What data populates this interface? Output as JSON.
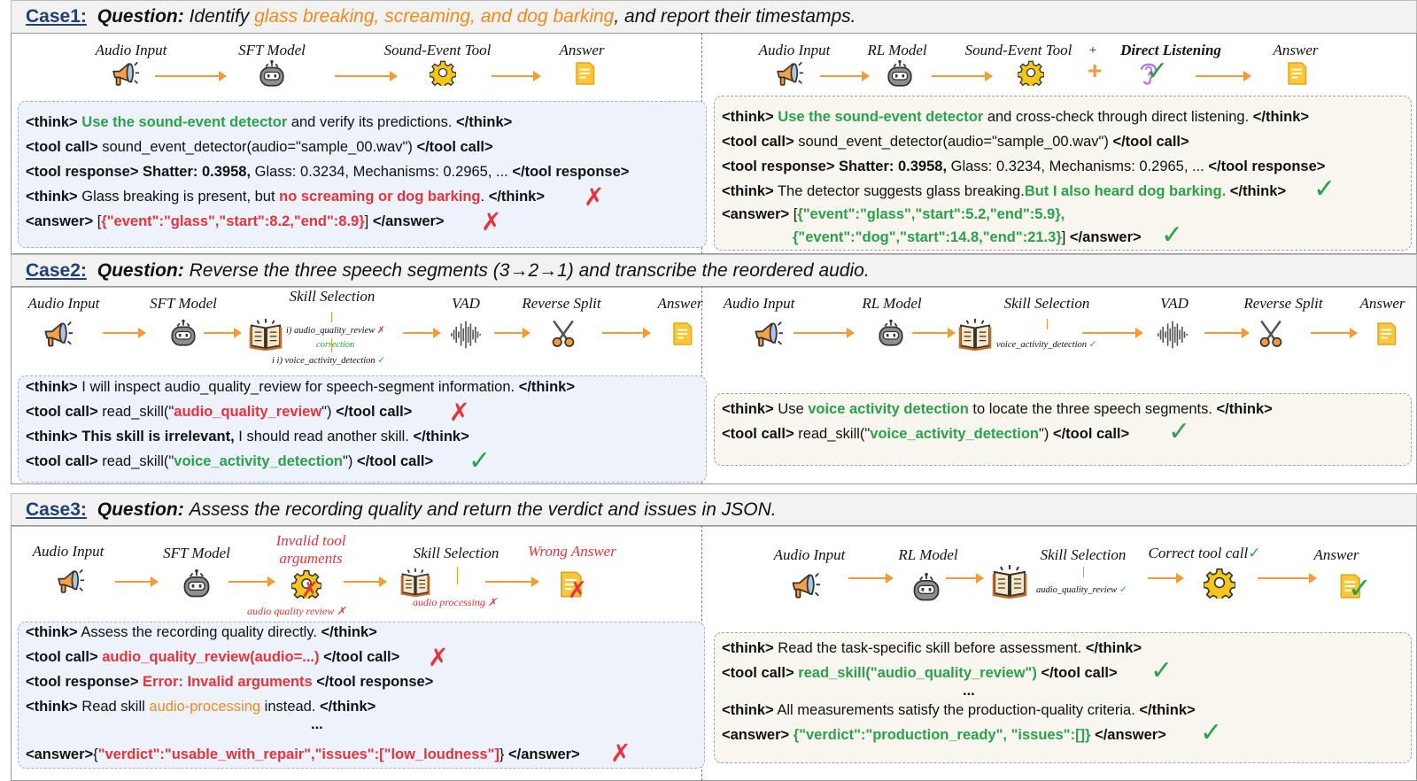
{
  "case1": {
    "num": "Case1:",
    "q_label": "Question:",
    "q_pre": "Identify ",
    "q_highlight": "glass breaking, screaming, and dog barking",
    "q_post": ", and report their timestamps.",
    "left_stages": [
      "Audio Input",
      "SFT Model",
      "Sound-Event Tool",
      "Answer"
    ],
    "right_stages": [
      "Audio Input",
      "RL Model",
      "Sound-Event Tool",
      "+",
      "Direct Listening",
      "Answer"
    ],
    "left_box": {
      "l1_tag": "<think>",
      "l1_g": "Use the sound-event detector",
      "l1_rest": " and verify its predictions. ",
      "l1_end": "</think>",
      "l2_tag": "<tool call>",
      "l2_rest": " sound_event_detector(audio=\"sample_00.wav\") ",
      "l2_end": "</tool call>",
      "l3_tag": "<tool response>",
      "l3_b": " Shatter: 0.3958,",
      "l3_rest": " Glass: 0.3234, Mechanisms: 0.2965, ... ",
      "l3_end": "</tool response>",
      "l4_tag": "<think>",
      "l4_rest": " Glass breaking is present, but ",
      "l4_r": "no screaming or dog barking",
      "l4_dot": ". ",
      "l4_end": "</think>",
      "l5_tag": "<answer>",
      "l5_open": " [",
      "l5_r": "{\"event\":\"glass\",\"start\":8.2,\"end\":8.9}",
      "l5_close": "] ",
      "l5_end": "</answer>"
    },
    "right_box": {
      "l1_tag": "<think>",
      "l1_g": "Use the sound-event detector",
      "l1_rest": " and cross-check through direct listening. ",
      "l1_end": "</think>",
      "l2_tag": "<tool call>",
      "l2_rest": " sound_event_detector(audio=\"sample_00.wav\") ",
      "l2_end": "</tool call>",
      "l3_tag": "<tool response>",
      "l3_b": " Shatter: 0.3958,",
      "l3_rest": " Glass: 0.3234, Mechanisms: 0.2965, ... ",
      "l3_end": "</tool response>",
      "l4_tag": "<think>",
      "l4_rest": " The detector suggests glass breaking.",
      "l4_g": "But I also heard dog barking",
      "l4_dot": ". ",
      "l4_end": "</think>",
      "l5_tag": "<answer>",
      "l5_open": " [",
      "l5_g1": "{\"event\":\"glass\",\"start\":5.2,\"end\":5.9},",
      "l6_g2": "{\"event\":\"dog\",\"start\":14.8,\"end\":21.3}",
      "l6_close": "] ",
      "l6_end": "</answer>"
    }
  },
  "case2": {
    "num": "Case2:",
    "q_label": "Question:",
    "q_text": "Reverse the three speech segments (3→2→1) and transcribe the reordered audio.",
    "left_stages": [
      "Audio Input",
      "SFT Model",
      "Skill Selection",
      "VAD",
      "Reverse Split",
      "Answer"
    ],
    "right_stages": [
      "Audio Input",
      "RL Model",
      "Skill Selection",
      "VAD",
      "Reverse Split",
      "Answer"
    ],
    "left_notes": {
      "first": "i)  audio_quality_review",
      "correction": "correction",
      "second": "i i)  voice_activity_detection"
    },
    "right_note": "voice_activity_detection",
    "left_box": {
      "l1_tag": "<think>",
      "l1_rest": " I will inspect audio_quality_review for speech-segment information. ",
      "l1_end": "</think>",
      "l2_tag": "<tool call>",
      "l2_pre": " read_skill(\"",
      "l2_r": "audio_quality_review",
      "l2_post": "\") ",
      "l2_end": "</tool call>",
      "l3_tag": "<think>",
      "l3_b": " This skill is irrelevant,",
      "l3_rest": " I should read another skill. ",
      "l3_end": "</think>",
      "l4_tag": "<tool call>",
      "l4_pre": " read_skill(\"",
      "l4_g": "voice_activity_detection",
      "l4_post": "\") ",
      "l4_end": "</tool call>"
    },
    "right_box": {
      "l1_tag": "<think>",
      "l1_pre": " Use ",
      "l1_g": "voice activity detection",
      "l1_rest": " to locate the three speech segments. ",
      "l1_end": "</think>",
      "l2_tag": "<tool call>",
      "l2_pre": " read_skill(\"",
      "l2_g": "voice_activity_detection",
      "l2_post": "\") ",
      "l2_end": "</tool call>"
    }
  },
  "case3": {
    "num": "Case3:",
    "q_label": "Question:",
    "q_text": "Assess the recording quality and return the verdict and issues in JSON.",
    "left_stages": [
      "Audio Input",
      "SFT Model",
      "Invalid tool",
      "arguments",
      "Skill Selection",
      "Wrong Answer"
    ],
    "left_notes": {
      "tool": "audio quality review",
      "skill": "audio processing"
    },
    "right_stages": [
      "Audio Input",
      "RL Model",
      "Skill Selection",
      "Correct tool  call",
      "Answer"
    ],
    "right_note": "audio_quality_review",
    "left_box": {
      "l1_tag": "<think>",
      "l1_rest": " Assess the recording quality directly. ",
      "l1_end": "</think>",
      "l2_tag": "<tool call>",
      "l2_r": " audio_quality_review(audio=...)",
      "l2_end": " </tool call>",
      "l3_tag": "<tool response>",
      "l3_r": " Error: Invalid arguments",
      "l3_end": " </tool response>",
      "l4_tag": "<think>",
      "l4_pre": " Read skill ",
      "l4_o": "audio-processing",
      "l4_rest": " instead. ",
      "l4_end": "</think>",
      "l5": "...",
      "l6_tag": "<answer>",
      "l6_open": "{",
      "l6_r": "\"verdict\":\"usable_with_repair\",\"issues\":[\"low_loudness\"]",
      "l6_close": "} ",
      "l6_end": "</answer>"
    },
    "right_box": {
      "l1_tag": "<think>",
      "l1_rest": " Read the task-specific skill before assessment. ",
      "l1_end": "</think>",
      "l2_tag": "<tool call>",
      "l2_g": " read_skill(\"audio_quality_review\")",
      "l2_end": " </tool call>",
      "l3": "...",
      "l4_tag": "<think>",
      "l4_rest": " All measurements satisfy the production-quality criteria. ",
      "l4_end": "</think>",
      "l5_tag": "<answer>",
      "l5_g": " {\"verdict\":\"production_ready\", \"issues\":[]}",
      "l5_end": " </answer>"
    }
  },
  "colors": {
    "arrow": "#f39a3a",
    "green": "#2aa14a",
    "red": "#e8333a",
    "orange": "#f08a1e",
    "blue_box": "#edf2fb",
    "beige_box": "#f8f6ee"
  }
}
